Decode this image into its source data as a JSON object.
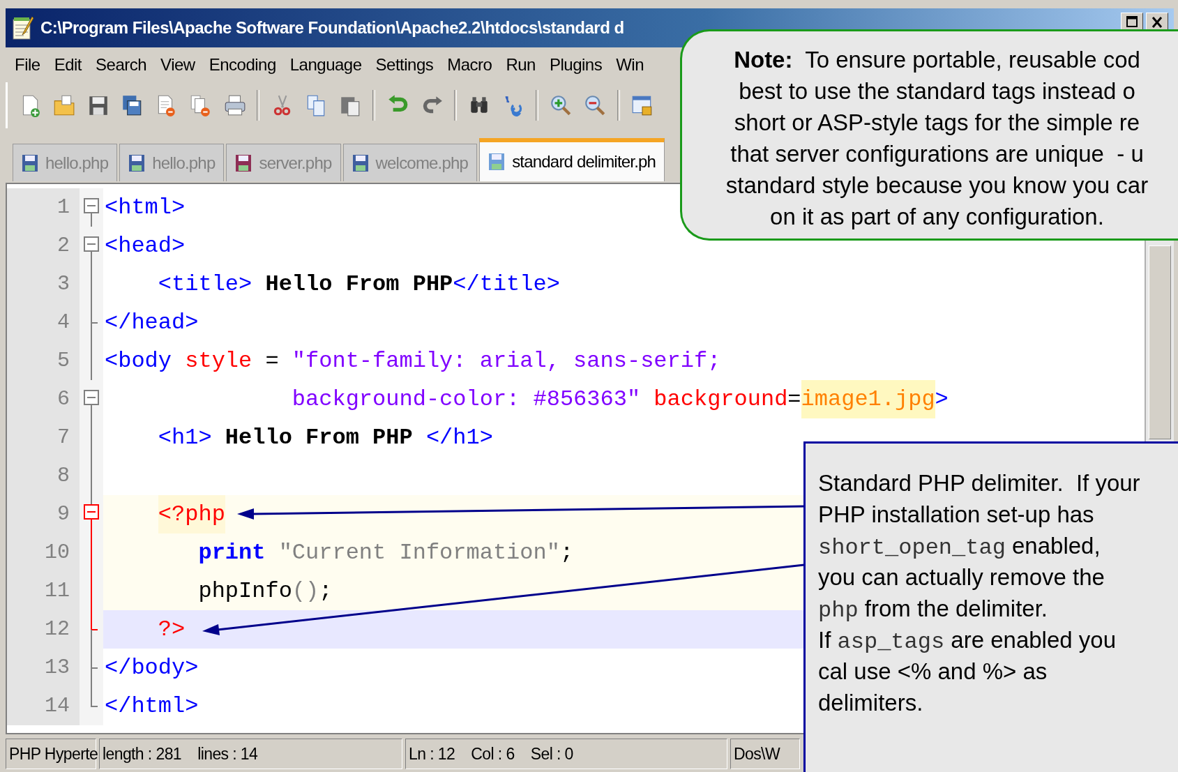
{
  "window": {
    "title": "C:\\Program Files\\Apache Software Foundation\\Apache2.2\\htdocs\\standard d"
  },
  "menu": [
    "File",
    "Edit",
    "Search",
    "View",
    "Encoding",
    "Language",
    "Settings",
    "Macro",
    "Run",
    "Plugins",
    "Win"
  ],
  "tabs": [
    {
      "label": "hello.php",
      "selected": false,
      "color": "#3f5f9f"
    },
    {
      "label": "hello.php",
      "selected": false,
      "color": "#3f5f9f"
    },
    {
      "label": "server.php",
      "selected": false,
      "color": "#8e2f55"
    },
    {
      "label": "welcome.php",
      "selected": false,
      "color": "#3f5f9f"
    },
    {
      "label": "standard delimiter.ph",
      "selected": true,
      "color": "#6f9fd8"
    }
  ],
  "editor": {
    "lines": [
      {
        "number": "1",
        "kind": "open",
        "current": false,
        "php_block": false,
        "tokens": [
          {
            "kind": "tag",
            "text": "<html>"
          }
        ]
      },
      {
        "number": "2",
        "kind": "open",
        "current": false,
        "php_block": false,
        "tokens": [
          {
            "kind": "tag",
            "text": "<head>"
          }
        ]
      },
      {
        "number": "3",
        "kind": "line",
        "current": false,
        "php_block": false,
        "indent": {
          "kind": "single"
        },
        "tokens": [
          {
            "kind": "tag",
            "text": "<title>"
          },
          {
            "kind": "text",
            "text": " Hello From PHP"
          },
          {
            "kind": "tag",
            "text": "</title>"
          }
        ]
      },
      {
        "number": "4",
        "kind": "end",
        "current": false,
        "php_block": false,
        "tokens": [
          {
            "kind": "tag",
            "text": "</head>"
          }
        ]
      },
      {
        "number": "5",
        "kind": "line",
        "current": false,
        "php_block": false,
        "tokens": [
          {
            "kind": "tag",
            "text": "<body"
          },
          {
            "kind": "attr",
            "text": " style"
          },
          {
            "kind": "plain",
            "text": " = "
          },
          {
            "kind": "string",
            "text": "\"font-family: arial, sans-serif;"
          }
        ]
      },
      {
        "number": "6",
        "kind": "open",
        "current": false,
        "php_block": false,
        "indent": {
          "kind": "wide"
        },
        "tokens": [
          {
            "kind": "string",
            "text": "background-color: #856363\""
          },
          {
            "kind": "attr",
            "text": " background"
          },
          {
            "kind": "plain",
            "text": "="
          },
          {
            "kind": "attr_value",
            "text": "image1.jpg"
          },
          {
            "kind": "tag",
            "text": ">"
          }
        ]
      },
      {
        "number": "7",
        "kind": "line",
        "current": false,
        "php_block": false,
        "indent": {
          "kind": "single"
        },
        "tokens": [
          {
            "kind": "tag",
            "text": "<h1>"
          },
          {
            "kind": "text",
            "text": " Hello From PHP "
          },
          {
            "kind": "tag",
            "text": "</h1>"
          }
        ]
      },
      {
        "number": "8",
        "kind": "line",
        "current": false,
        "php_block": false
      },
      {
        "number": "9",
        "kind": "php_open",
        "current": false,
        "php_block": true,
        "indent": {
          "kind": "single"
        },
        "tokens": [
          {
            "kind": "php_open_tag",
            "text": "<?php"
          }
        ]
      },
      {
        "number": "10",
        "kind": "php_line",
        "current": false,
        "php_block": true,
        "indent": {
          "kind": "double"
        },
        "tokens": [
          {
            "kind": "keyword",
            "text": "print"
          },
          {
            "kind": "literal",
            "text": " \"Current Information\""
          },
          {
            "kind": "plain",
            "text": ";"
          }
        ]
      },
      {
        "number": "11",
        "kind": "php_line",
        "current": false,
        "php_block": true,
        "indent": {
          "kind": "double"
        },
        "tokens": [
          {
            "kind": "plain",
            "text": "phpInfo"
          },
          {
            "kind": "literal",
            "text": "()"
          },
          {
            "kind": "plain",
            "text": ";"
          }
        ]
      },
      {
        "number": "12",
        "kind": "php_end",
        "current": true,
        "php_block": false,
        "indent": {
          "kind": "single"
        },
        "tokens": [
          {
            "kind": "php_close_tag",
            "text": "?>"
          }
        ]
      },
      {
        "number": "13",
        "kind": "end",
        "current": false,
        "php_block": false,
        "tokens": [
          {
            "kind": "tag",
            "text": "</body>"
          }
        ]
      },
      {
        "number": "14",
        "kind": "last",
        "current": false,
        "php_block": false,
        "tokens": [
          {
            "kind": "tag",
            "text": "</html>"
          }
        ]
      }
    ]
  },
  "status_bar": {
    "cells": [
      "PHP Hyperte",
      "length : 281    lines : 14",
      "Ln : 12    Col : 6    Sel : 0",
      "Dos\\W"
    ]
  },
  "note": {
    "lines": [
      "**Note:**  To ensure portable, reusable cod",
      "best to use the standard tags instead o",
      "short or ASP-style tags for the simple re",
      "that server configurations are unique  - u",
      "standard style because you know you car",
      "on it as part of any configuration."
    ]
  },
  "callout": {
    "paragraphs": [
      [
        {
          "kind": "text",
          "text": "Standard PHP delimiter.  If your PHP installation set-up has "
        },
        {
          "kind": "code",
          "text": "short_open_tag"
        },
        {
          "kind": "text",
          "text": " enabled, you can actually remove the "
        },
        {
          "kind": "code",
          "text": "php"
        },
        {
          "kind": "text",
          "text": " from the delimiter."
        }
      ],
      [
        {
          "kind": "text",
          "text": "If "
        },
        {
          "kind": "code",
          "text": "asp_tags"
        },
        {
          "kind": "text",
          "text": " are enabled you cal use <% and %> as delimiters."
        }
      ]
    ]
  }
}
